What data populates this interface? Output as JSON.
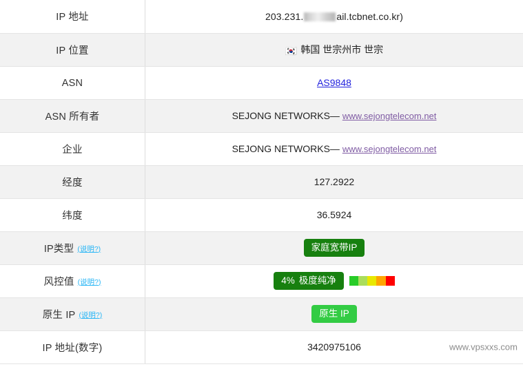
{
  "table": {
    "rows": [
      {
        "label": "IP 地址",
        "type": "ip",
        "value_prefix": "203.231.",
        "value_suffix": "ail.tcbnet.co.kr)",
        "redacted": true
      },
      {
        "label": "IP 位置",
        "type": "location",
        "flag": "kr-flag-icon",
        "flag_glyph": "🇰🇷",
        "value": "韩国 世宗州市 世宗"
      },
      {
        "label": "ASN",
        "type": "link",
        "value": "AS9848",
        "link_color": "#2222dd"
      },
      {
        "label": "ASN 所有者",
        "type": "org",
        "org": "SEJONG NETWORKS—",
        "url": "www.sejongtelecom.net"
      },
      {
        "label": "企业",
        "type": "org",
        "org": "SEJONG NETWORKS—",
        "url": "www.sejongtelecom.net"
      },
      {
        "label": "经度",
        "type": "text",
        "value": "127.2922"
      },
      {
        "label": "纬度",
        "type": "text",
        "value": "36.5924"
      },
      {
        "label": "IP类型",
        "help": "(说明?)",
        "type": "badge",
        "badge_text": "家庭宽带IP",
        "badge_color": "#17800f"
      },
      {
        "label": "风控值",
        "help": "(说明?)",
        "type": "risk",
        "percent": "4%",
        "rating": "极度纯净",
        "badge_color": "#17800f",
        "scale_colors": [
          "#28cc28",
          "#aadd5c",
          "#e8e800",
          "#ffa500",
          "#ff0000"
        ]
      },
      {
        "label": "原生 IP",
        "help": "(说明?)",
        "type": "badge",
        "badge_text": "原生 IP",
        "badge_color": "#33cc44"
      },
      {
        "label": "IP 地址(数字)",
        "type": "text",
        "value": "3420975106",
        "watermark": "www.vpsxxs.com"
      }
    ]
  }
}
